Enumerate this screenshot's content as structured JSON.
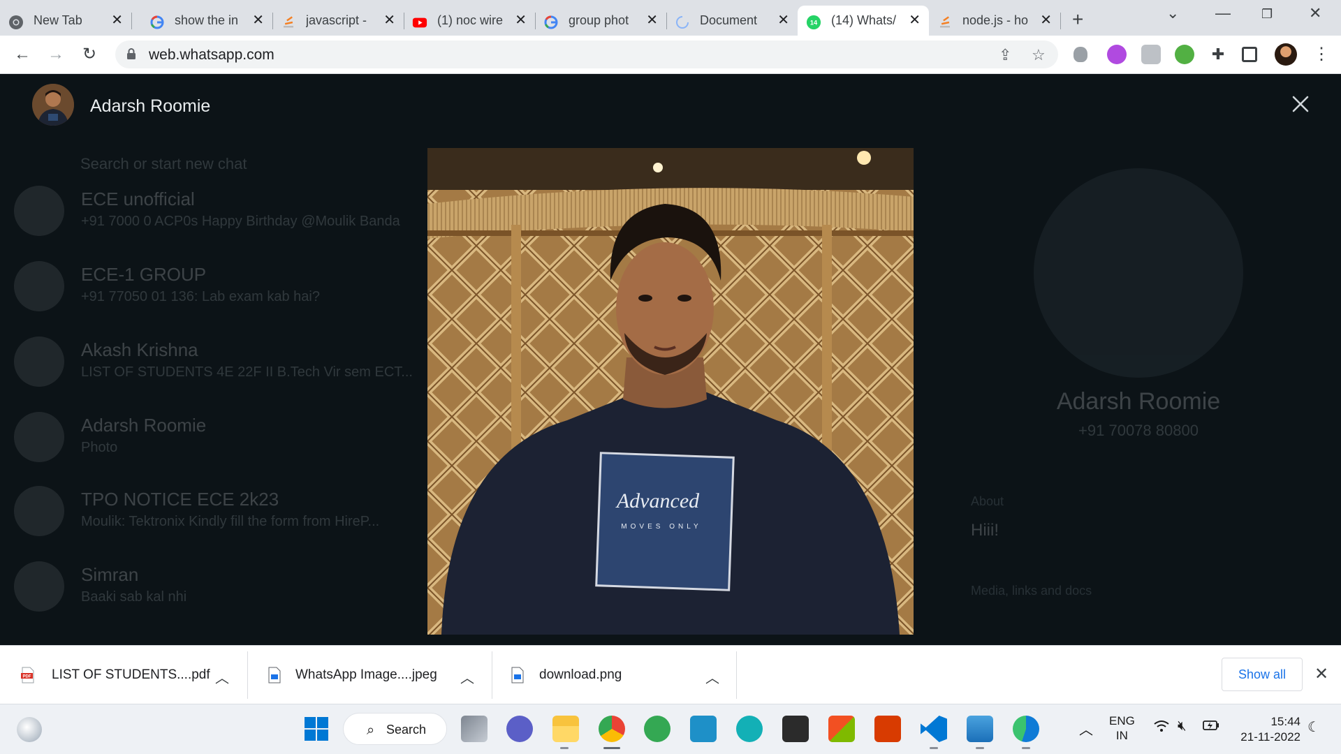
{
  "browser": {
    "tabs": [
      {
        "title": "New Tab",
        "icon": "chrome-icon"
      },
      {
        "title": "show the in",
        "icon": "google-icon"
      },
      {
        "title": "javascript -",
        "icon": "stackoverflow-icon"
      },
      {
        "title": "(1) noc wire",
        "icon": "youtube-icon"
      },
      {
        "title": "group phot",
        "icon": "google-icon"
      },
      {
        "title": "Document",
        "icon": "loading-icon"
      },
      {
        "title": "(14) Whats/",
        "icon": "whatsapp-icon",
        "badge": "14",
        "active": true
      },
      {
        "title": "node.js - ho",
        "icon": "stackoverflow-icon"
      }
    ],
    "url": "web.whatsapp.com"
  },
  "viewer": {
    "contact_name": "Adarsh Roomie"
  },
  "background_chats": {
    "search_placeholder": "Search or start new chat",
    "chats": [
      {
        "name": "ECE unofficial",
        "preview": "+91 7000 0 ACP0s Happy Birthday @Moulik Banda"
      },
      {
        "name": "ECE-1 GROUP",
        "preview": "+91 77050 01 136: Lab exam kab hai?"
      },
      {
        "name": "Akash Krishna",
        "preview": "LIST OF STUDENTS 4E 22F II B.Tech Vir sem ECT..."
      },
      {
        "name": "Adarsh Roomie",
        "preview": "Photo"
      },
      {
        "name": "TPO NOTICE ECE 2k23",
        "preview": "Moulik: Tektronix Kindly fill the form from HireP..."
      },
      {
        "name": "Simran",
        "preview": "Baaki sab kal nhi"
      }
    ],
    "contact_info": {
      "name": "Adarsh Roomie",
      "phone": "+91 70078 80800",
      "about_label": "About",
      "about_text": "Hiii!",
      "media_label": "Media, links and docs"
    }
  },
  "downloads": {
    "items": [
      {
        "name": "LIST OF STUDENTS....pdf",
        "icon": "pdf-file-icon"
      },
      {
        "name": "WhatsApp Image....jpeg",
        "icon": "image-file-icon"
      },
      {
        "name": "download.png",
        "icon": "image-file-icon"
      }
    ],
    "show_all": "Show all"
  },
  "taskbar": {
    "search_label": "Search",
    "lang_line1": "ENG",
    "lang_line2": "IN",
    "time": "15:44",
    "date": "21-11-2022"
  },
  "colors": {
    "viewer_bg": "#0c1317",
    "tabstrip": "#dee1e6",
    "accent_blue": "#1a73e8",
    "whatsapp_green": "#25d366"
  }
}
